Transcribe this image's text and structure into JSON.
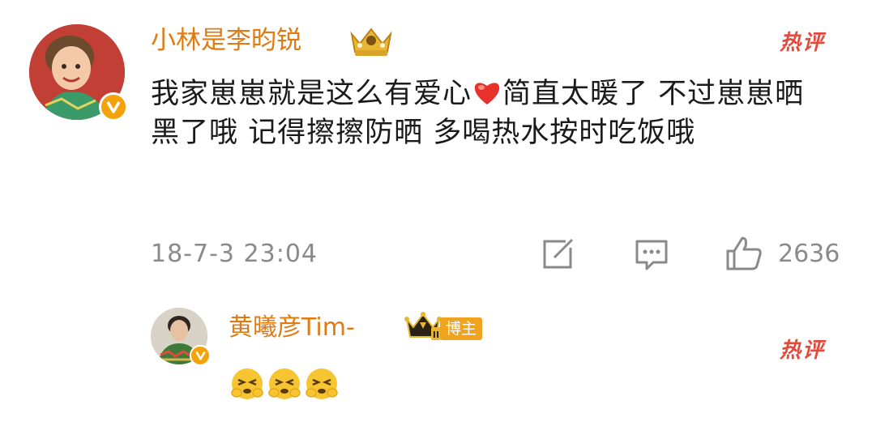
{
  "comment": {
    "username": "小林是李昀锐",
    "text": "我家崽崽就是这么有爱心",
    "text_after_heart": "简直太暖了 不过崽崽晒黑了哦 记得擦擦防晒 多喝热水按时吃饭哦",
    "timestamp": "18-7-3 23:04",
    "like_count": "2636",
    "hot_label": "热评"
  },
  "reply": {
    "username": "黄曦彦Tim-",
    "role_badge": "博主",
    "hot_label": "热评",
    "emoji_name": "squinting-face-emoji",
    "emoji_count": 3
  },
  "icons": {
    "heart": "heart-icon",
    "share": "share-icon",
    "comment": "comment-icon",
    "like": "thumbs-up-icon",
    "crown": "crown-icon",
    "verified": "verified-v-icon"
  },
  "colors": {
    "username": "#e07b12",
    "hot_label": "#e24a3b",
    "meta_text": "#8a8a8a",
    "badge": "#f2a30b"
  }
}
